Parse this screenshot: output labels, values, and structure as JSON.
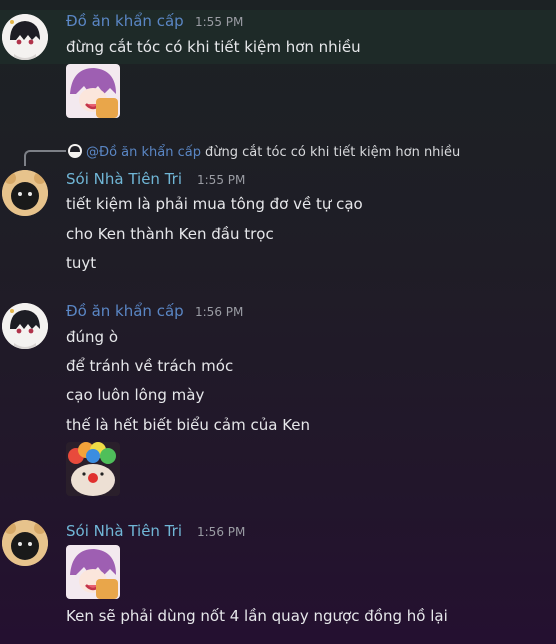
{
  "messages": [
    {
      "username": "Đồ ăn khẩn cấp",
      "time": "1:55 PM",
      "lines": [
        "đừng cắt tóc có khi tiết kiệm hơn nhiều"
      ],
      "attachment": "anime-girl-sticker"
    },
    {
      "reply": {
        "mention": "@Đồ ăn khẩn cấp",
        "text": "đừng cắt tóc có khi tiết kiệm hơn nhiều"
      },
      "username": "Sói Nhà Tiên Tri",
      "time": "1:55 PM",
      "lines": [
        "tiết kiệm là phải mua tông đơ về tự cạo",
        "cho Ken thành Ken đầu trọc",
        "tuyt"
      ]
    },
    {
      "username": "Đồ ăn khẩn cấp",
      "time": "1:56 PM",
      "lines": [
        "đúng ò",
        "để tránh về trách móc",
        "cạo luôn lông mày",
        "thế là hết biết biểu cảm của Ken"
      ],
      "attachment": "clown-rainbow-sticker"
    },
    {
      "username": "Sói Nhà Tiên Tri",
      "time": "1:56 PM",
      "attachment": "anime-girl-sticker",
      "lines": [
        "Ken sẽ phải dùng nốt 4 lần quay ngược đồng hồ lại"
      ]
    }
  ],
  "colors": {
    "username_1": "#5a86c4",
    "username_2": "#70b6d6",
    "text": "#e6e7ea",
    "timestamp": "#9a9ca3"
  }
}
